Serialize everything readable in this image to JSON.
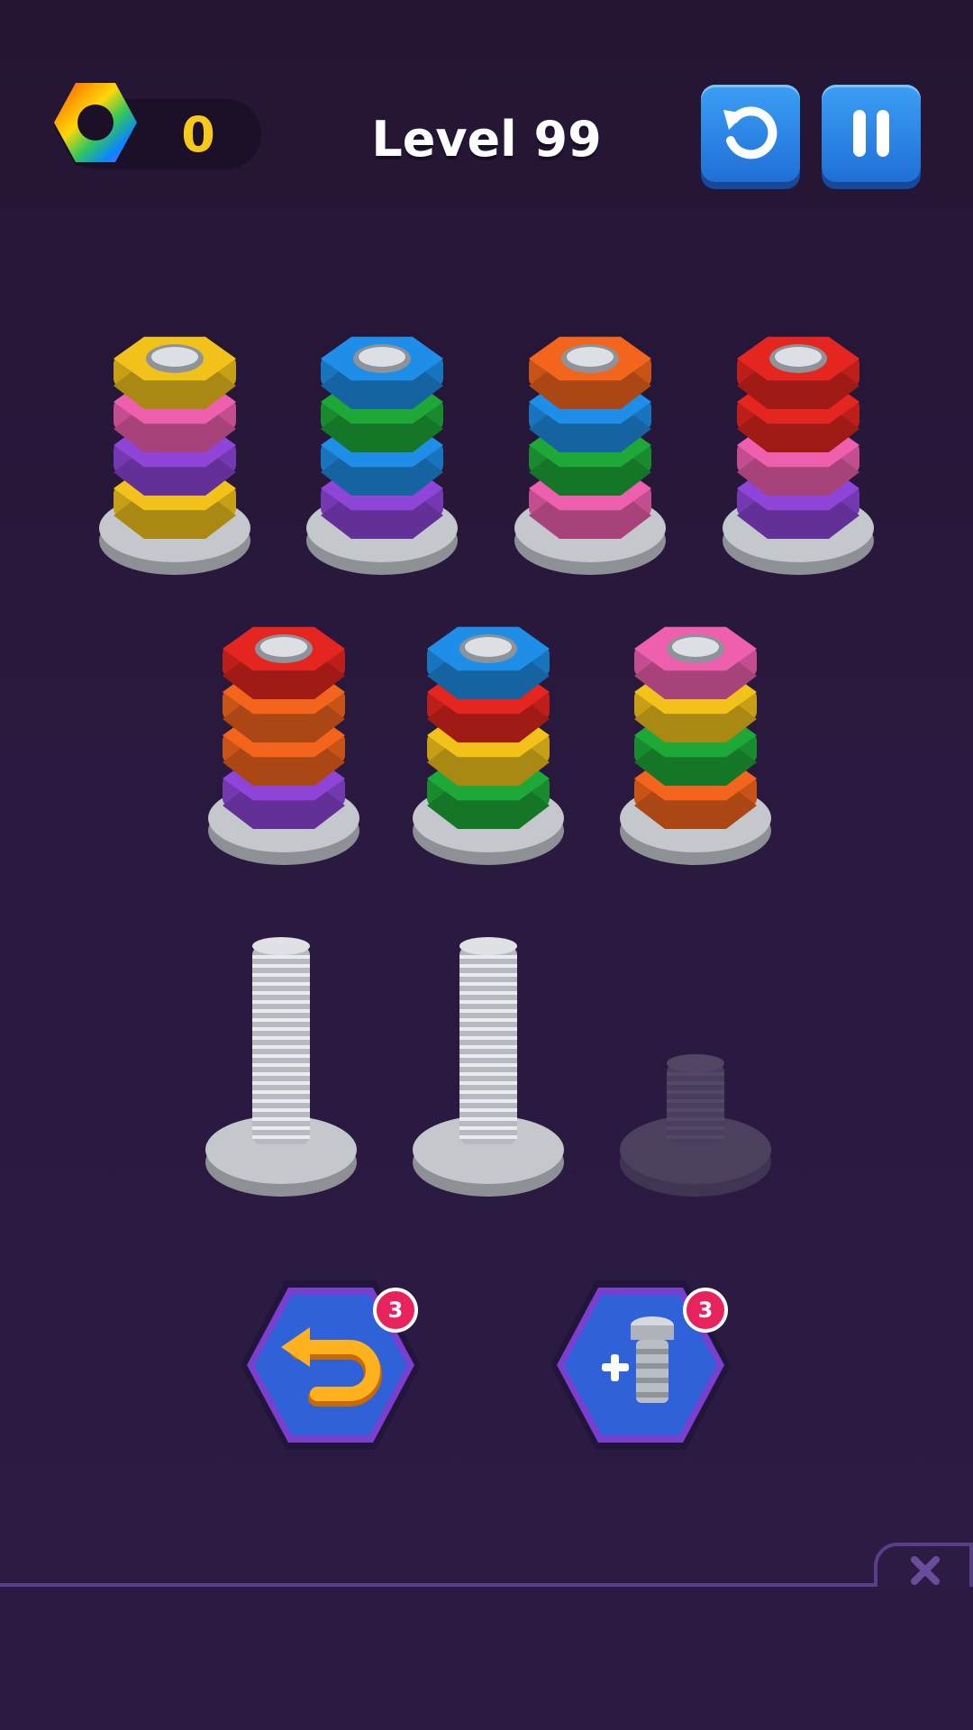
{
  "header": {
    "score": "0",
    "level_title": "Level 99",
    "score_icon": "rainbow-nut-icon",
    "restart_icon": "restart-icon",
    "pause_icon": "pause-icon"
  },
  "colors": {
    "yellow": "#f2c21b",
    "pink": "#ee5fae",
    "purple": "#8e45d8",
    "blue": "#1f8ee8",
    "green": "#1ea838",
    "orange": "#f3651c",
    "red": "#e5251f"
  },
  "bolts": [
    {
      "id": 1,
      "nuts_bottom_to_top": [
        "yellow",
        "purple",
        "pink",
        "yellow"
      ]
    },
    {
      "id": 2,
      "nuts_bottom_to_top": [
        "purple",
        "blue",
        "green",
        "blue"
      ]
    },
    {
      "id": 3,
      "nuts_bottom_to_top": [
        "pink",
        "green",
        "blue",
        "orange"
      ]
    },
    {
      "id": 4,
      "nuts_bottom_to_top": [
        "purple",
        "pink",
        "red",
        "red"
      ]
    },
    {
      "id": 5,
      "nuts_bottom_to_top": [
        "purple",
        "orange",
        "orange",
        "red"
      ]
    },
    {
      "id": 6,
      "nuts_bottom_to_top": [
        "green",
        "yellow",
        "red",
        "blue"
      ]
    },
    {
      "id": 7,
      "nuts_bottom_to_top": [
        "orange",
        "green",
        "yellow",
        "pink"
      ]
    },
    {
      "id": 8,
      "nuts_bottom_to_top": [],
      "state": "empty"
    },
    {
      "id": 9,
      "nuts_bottom_to_top": [],
      "state": "empty"
    },
    {
      "id": 10,
      "nuts_bottom_to_top": [],
      "state": "locked"
    }
  ],
  "powerups": {
    "undo": {
      "icon": "undo-arrow-icon",
      "count": "3"
    },
    "add_bolt": {
      "icon": "add-bolt-icon",
      "count": "3"
    }
  },
  "ad_close_icon": "close-icon"
}
